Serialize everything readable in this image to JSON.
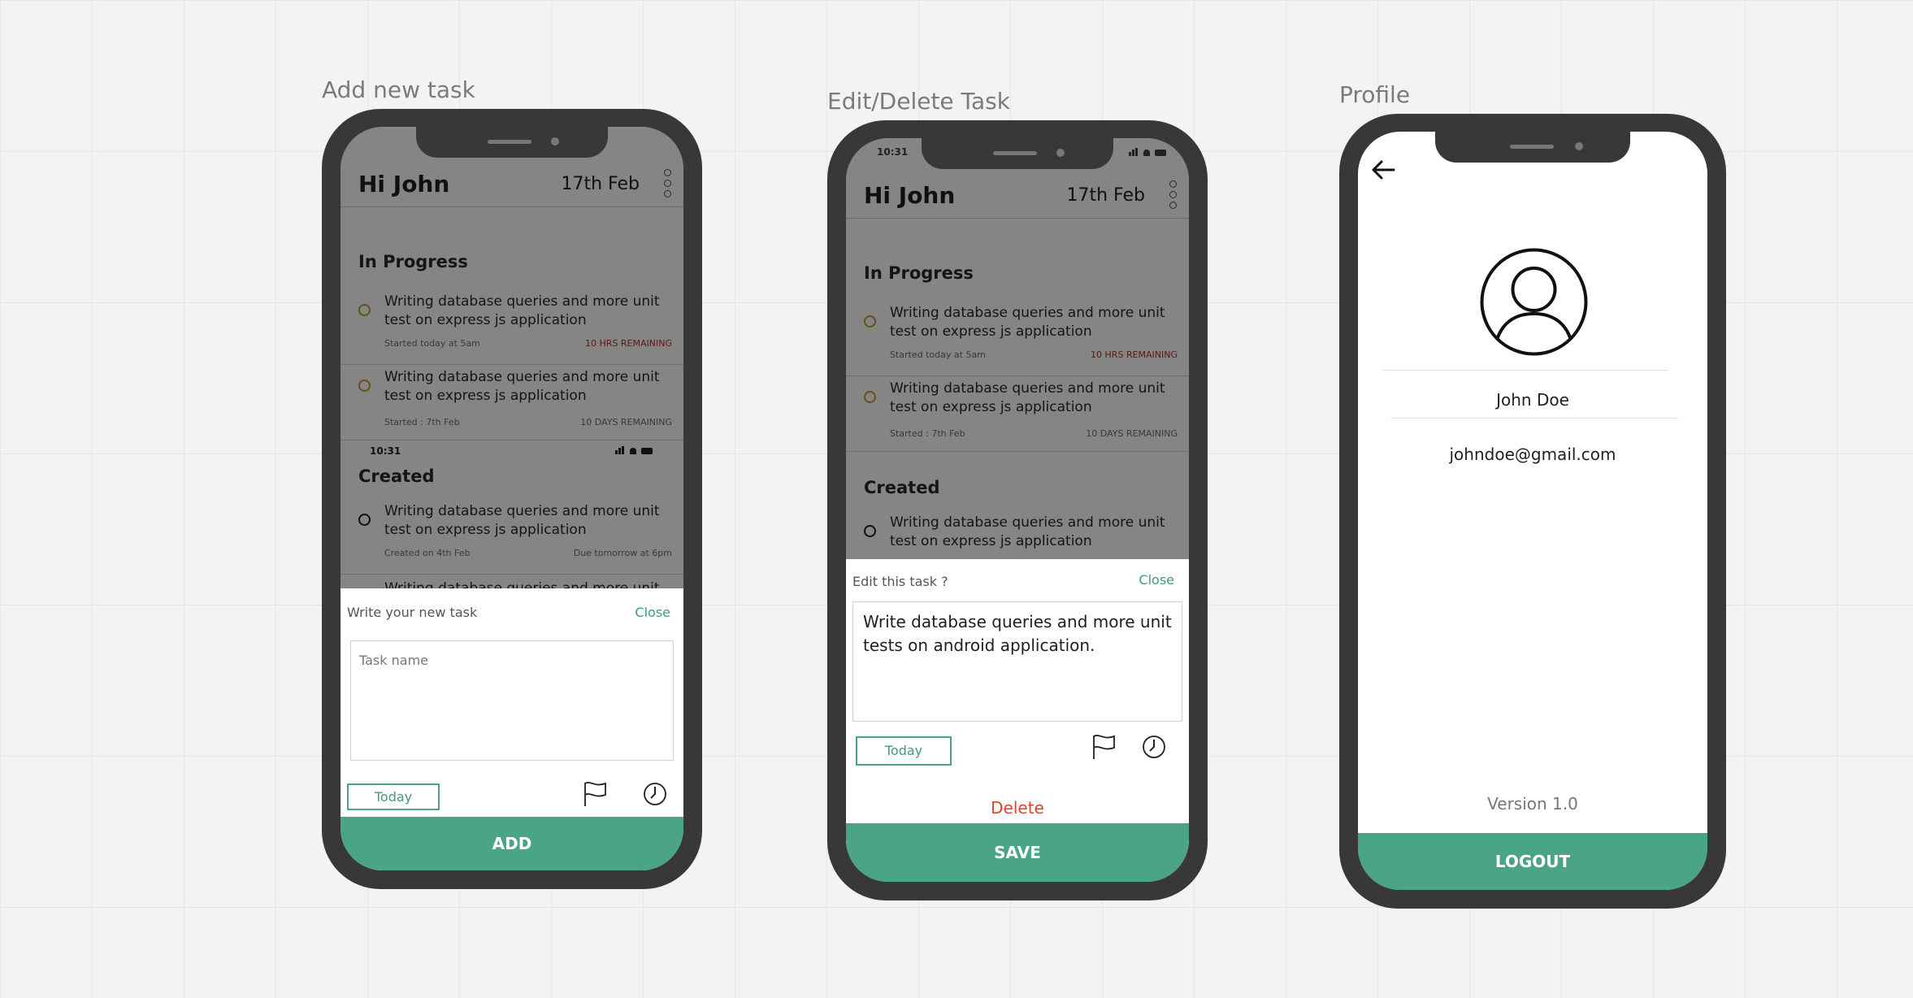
{
  "frames": {
    "add": "Add new task",
    "edit": "Edit/Delete Task",
    "profile": "Profile"
  },
  "home": {
    "greeting": "Hi John",
    "date": "17th Feb",
    "in_progress_title": "In Progress",
    "created_title": "Created",
    "status_time": "10:31",
    "tasks": [
      {
        "text": "Writing database queries and more unit test on express js application",
        "left": "Started today at 5am",
        "right": "10 HRS REMAINING"
      },
      {
        "text": "Writing database queries and more unit test on express js application",
        "left": "Started : 7th Feb",
        "right": "10 DAYS REMAINING"
      },
      {
        "text": "Writing database queries and more unit test on express js application",
        "left": "Created on 4th Feb",
        "right": "Due tomorrow at 6pm"
      },
      {
        "text": "Writing database queries and more unit test on"
      }
    ]
  },
  "add_sheet": {
    "label": "Write your new task",
    "close": "Close",
    "placeholder": "Task name",
    "today": "Today",
    "submit": "ADD"
  },
  "edit_sheet": {
    "label": "Edit this task ?",
    "close": "Close",
    "value": "Write database queries and more unit tests on android application.",
    "today": "Today",
    "delete": "Delete",
    "submit": "SAVE"
  },
  "profile": {
    "name": "John Doe",
    "email": "johndoe@gmail.com",
    "version": "Version 1.0",
    "logout": "LOGOUT"
  },
  "colors": {
    "accent": "#4aa486",
    "danger": "#e4412b",
    "in_progress_dot": "#c79a2a",
    "phone_frame": "#383838"
  },
  "icons": [
    "flag-icon",
    "clock-icon",
    "back-arrow-icon",
    "user-avatar-icon",
    "kebab-menu-icon"
  ]
}
